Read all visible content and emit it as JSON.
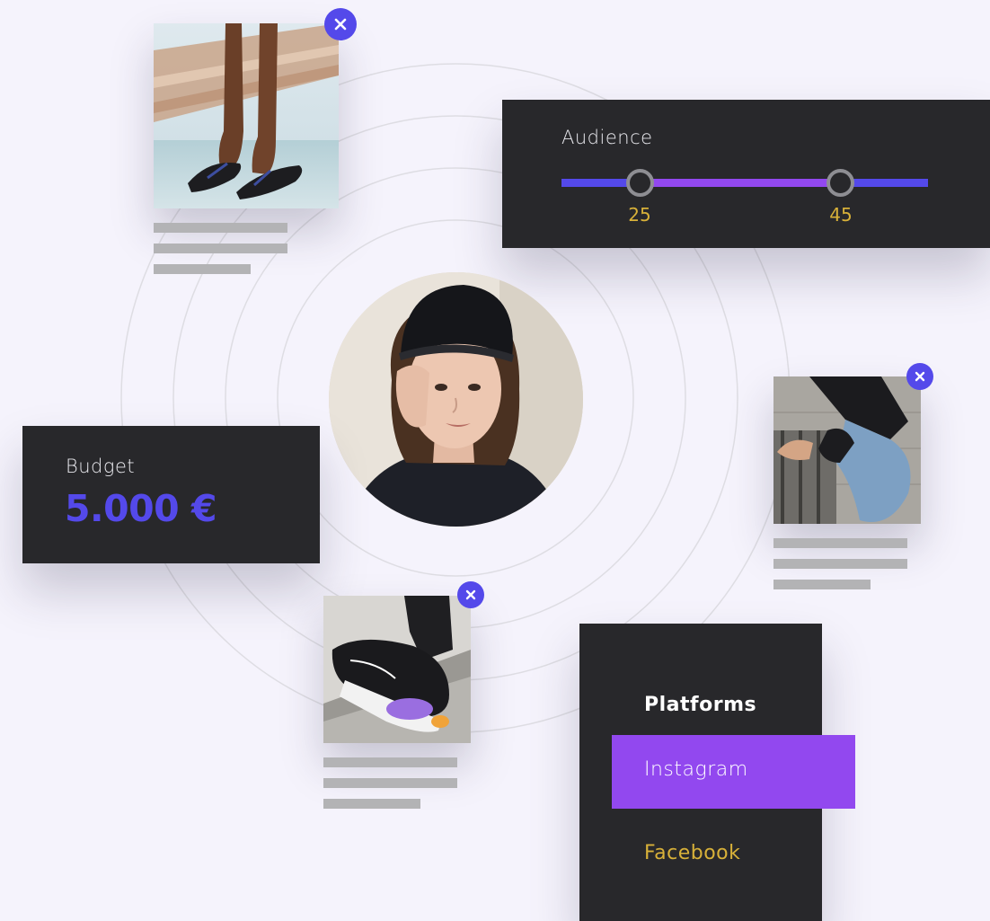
{
  "audience": {
    "label": "Audience",
    "min_value": "25",
    "max_value": "45",
    "track_color": "#5449ea",
    "range_color": "#9248ef"
  },
  "budget": {
    "label": "Budget",
    "value": "5.000 €"
  },
  "platforms": {
    "title": "Platforms",
    "items": [
      {
        "label": "Instagram",
        "selected": true
      },
      {
        "label": "Facebook",
        "selected": false
      }
    ]
  },
  "media_cards": [
    {
      "subject": "flip-flops",
      "remove_icon": "close-icon"
    },
    {
      "subject": "boots",
      "remove_icon": "close-icon"
    },
    {
      "subject": "sneaker",
      "remove_icon": "close-icon"
    }
  ],
  "colors": {
    "background": "#f5f3fc",
    "panel": "#28282b",
    "accent_blue": "#5449ea",
    "accent_purple": "#9248ef",
    "highlight_gold": "#d8b139",
    "placeholder_bar": "#b3b3b5"
  }
}
